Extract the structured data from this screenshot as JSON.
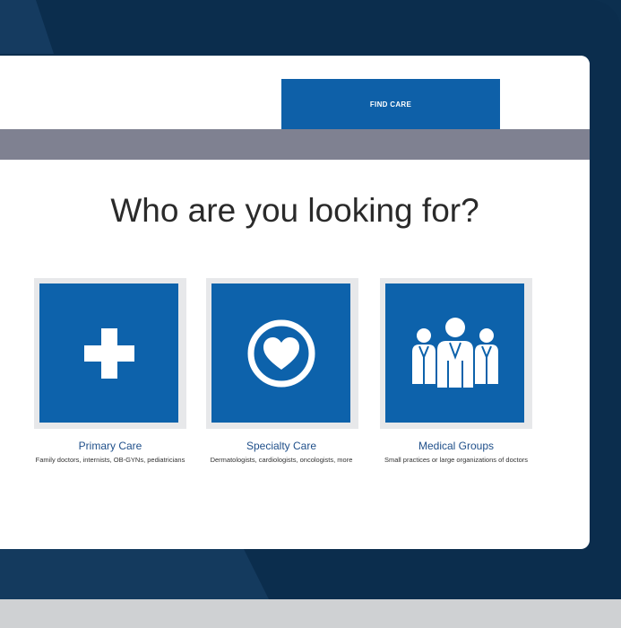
{
  "header": {
    "find_care_label": "FIND CARE"
  },
  "main": {
    "heading": "Who are you looking for?",
    "cards": [
      {
        "title": "Primary Care",
        "description": "Family doctors, internists, OB-GYNs, pediatricians",
        "icon": "medical-cross-icon"
      },
      {
        "title": "Specialty Care",
        "description": "Dermatologists, cardiologists, oncologists, more",
        "icon": "heart-circle-icon"
      },
      {
        "title": "Medical Groups",
        "description": "Small practices or large organizations of doctors",
        "icon": "doctors-group-icon"
      }
    ]
  },
  "colors": {
    "accent": "#0d62ab",
    "band": "#7f8191",
    "bezel": "#0b2d4d"
  }
}
